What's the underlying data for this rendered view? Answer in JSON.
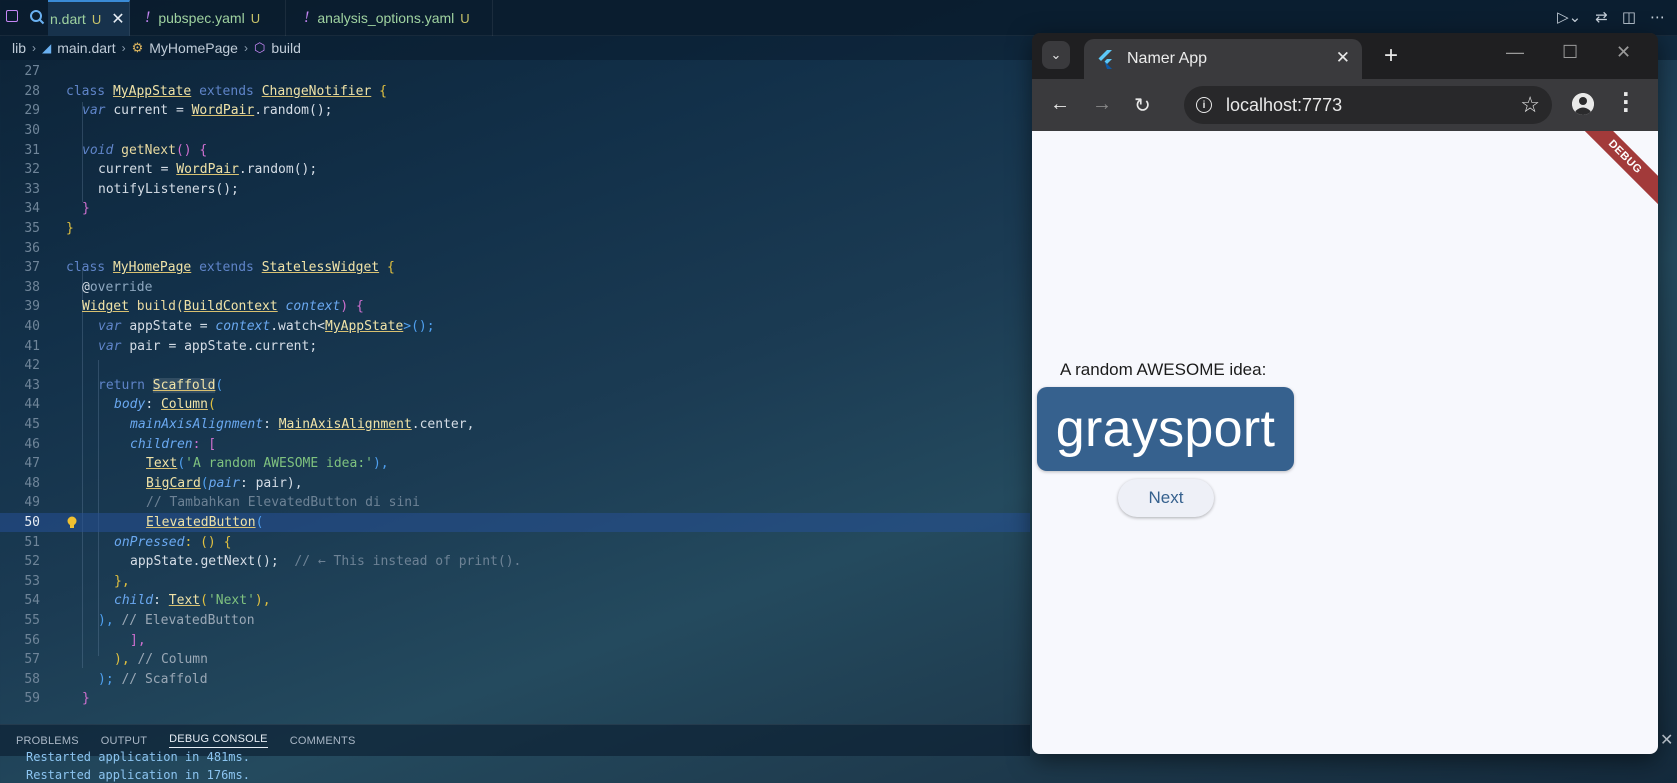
{
  "editor": {
    "tabs": [
      {
        "label": "n.dart",
        "badge": "U"
      },
      {
        "label": "pubspec.yaml",
        "badge": "U",
        "marker": "!"
      },
      {
        "label": "analysis_options.yaml",
        "badge": "U",
        "marker": "!"
      }
    ],
    "breadcrumb": [
      "lib",
      "main.dart",
      "MyHomePage",
      "build"
    ],
    "current_line": 50,
    "line_numbers": [
      "27",
      "28",
      "29",
      "30",
      "31",
      "32",
      "33",
      "34",
      "35",
      "36",
      "37",
      "38",
      "39",
      "40",
      "41",
      "42",
      "43",
      "44",
      "45",
      "46",
      "47",
      "48",
      "49",
      "50",
      "51",
      "52",
      "53",
      "54",
      "55",
      "56",
      "57",
      "58",
      "59"
    ],
    "code": {
      "l28": [
        "class",
        "MyAppState",
        "extends",
        "ChangeNotifier",
        "{"
      ],
      "l29": [
        "var",
        "current",
        "=",
        "WordPair",
        ".random();"
      ],
      "l31": [
        "void",
        "getNext",
        "() {"
      ],
      "l32": [
        "current = ",
        "WordPair",
        ".random();"
      ],
      "l33": "notifyListeners();",
      "l34": "}",
      "l35": "}",
      "l37": [
        "class",
        "MyHomePage",
        "extends",
        "StatelessWidget",
        "{"
      ],
      "l38": [
        "@",
        "override"
      ],
      "l39": [
        "Widget",
        "build(",
        "BuildContext",
        "context",
        ") {"
      ],
      "l40": [
        "var",
        "appState = ",
        "context",
        ".watch<",
        "MyAppState",
        ">();"
      ],
      "l41": [
        "var",
        "pair = appState.current;"
      ],
      "l43": [
        "return",
        "Scaffold",
        "("
      ],
      "l44": [
        "body",
        ": ",
        "Column",
        "("
      ],
      "l45": [
        "mainAxisAlignment",
        ": ",
        "MainAxisAlignment",
        ".center,"
      ],
      "l46": [
        "children",
        ": ["
      ],
      "l47": [
        "Text",
        "(",
        "'A random AWESOME idea:'",
        "),"
      ],
      "l48": [
        "BigCard",
        "(",
        "pair",
        ": pair),"
      ],
      "l49": "// Tambahkan ElevatedButton di sini",
      "l50": [
        "ElevatedButton",
        "("
      ],
      "l51": [
        "onPressed",
        ": () {"
      ],
      "l52": [
        "appState.getNext();",
        "// ← This instead of print()."
      ],
      "l53": "},",
      "l54": [
        "child",
        ": ",
        "Text",
        "(",
        "'Next'",
        "),"
      ],
      "l55": [
        "),",
        "// ElevatedButton"
      ],
      "l56": "],",
      "l57": [
        "),",
        "// Column"
      ],
      "l58": [
        ");",
        "// Scaffold"
      ],
      "l59": "}"
    },
    "panel_tabs": [
      "PROBLEMS",
      "OUTPUT",
      "DEBUG CONSOLE",
      "COMMENTS"
    ],
    "console_lines": [
      "Restarted application in 481ms.",
      "Restarted application in 176ms."
    ]
  },
  "browser": {
    "tab_title": "Namer App",
    "url": "localhost:7773",
    "page": {
      "debug_banner": "DEBUG",
      "idea_label": "A random AWESOME idea:",
      "word_pair": "graysport",
      "next_button": "Next"
    }
  },
  "colors": {
    "card": "#36618e",
    "page_bg": "#f7f8fd",
    "debug_ribbon": "#a23a3a",
    "current_line": "#265096"
  }
}
